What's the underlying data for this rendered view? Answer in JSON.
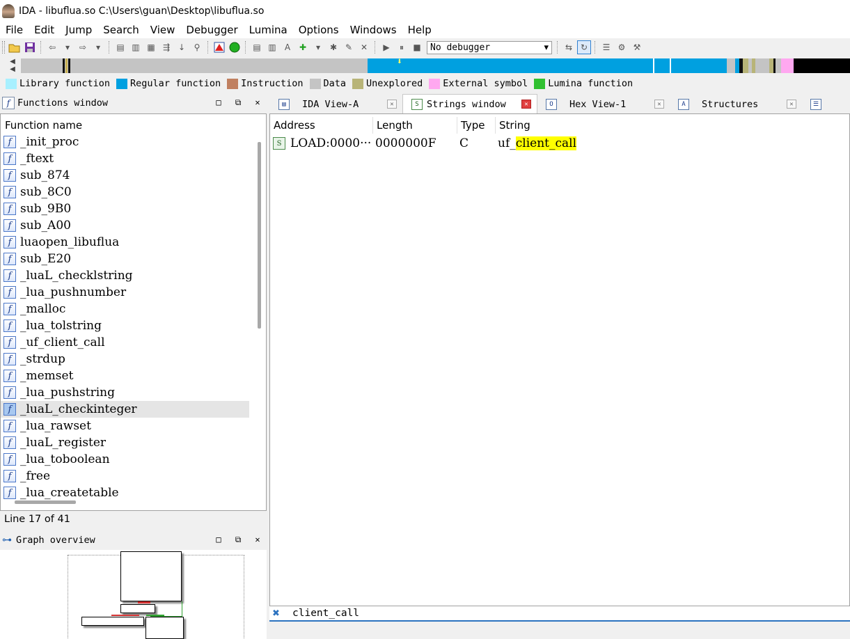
{
  "window": {
    "title": "IDA - libuflua.so C:\\Users\\guan\\Desktop\\libuflua.so"
  },
  "menu": [
    "File",
    "Edit",
    "Jump",
    "Search",
    "View",
    "Debugger",
    "Lumina",
    "Options",
    "Windows",
    "Help"
  ],
  "toolbar": {
    "debugger_select": "No debugger"
  },
  "legend": [
    {
      "label": "Library function",
      "color": "#a8f0ff"
    },
    {
      "label": "Regular function",
      "color": "#00a0e0"
    },
    {
      "label": "Instruction",
      "color": "#c08060"
    },
    {
      "label": "Data",
      "color": "#c4c4c4"
    },
    {
      "label": "Unexplored",
      "color": "#b8b478"
    },
    {
      "label": "External symbol",
      "color": "#ffa8f0"
    },
    {
      "label": "Lumina function",
      "color": "#30c030"
    }
  ],
  "functions_window": {
    "title": "Functions window",
    "column": "Function name",
    "items": [
      "_init_proc",
      "_ftext",
      "sub_874",
      "sub_8C0",
      "sub_9B0",
      "sub_A00",
      "luaopen_libuflua",
      "sub_E20",
      "_luaL_checklstring",
      "_lua_pushnumber",
      "_malloc",
      "_lua_tolstring",
      "_uf_client_call",
      "_strdup",
      "_memset",
      "_lua_pushstring",
      "_luaL_checkinteger",
      "_lua_rawset",
      "_luaL_register",
      "_lua_toboolean",
      "_free",
      "_lua_createtable"
    ],
    "status": "Line 17 of 41"
  },
  "graph_overview": {
    "title": "Graph overview"
  },
  "tabs": [
    {
      "label": "IDA View-A"
    },
    {
      "label": "Strings window"
    },
    {
      "label": "Hex View-1"
    },
    {
      "label": "Structures"
    }
  ],
  "strings": {
    "headers": [
      "Address",
      "Length",
      "Type",
      "String"
    ],
    "row": {
      "address": "LOAD:0000···",
      "length": "0000000F",
      "type": "C",
      "string_prefix": "uf_",
      "string_match": "client_call"
    }
  },
  "filter": {
    "text": "client_call"
  }
}
